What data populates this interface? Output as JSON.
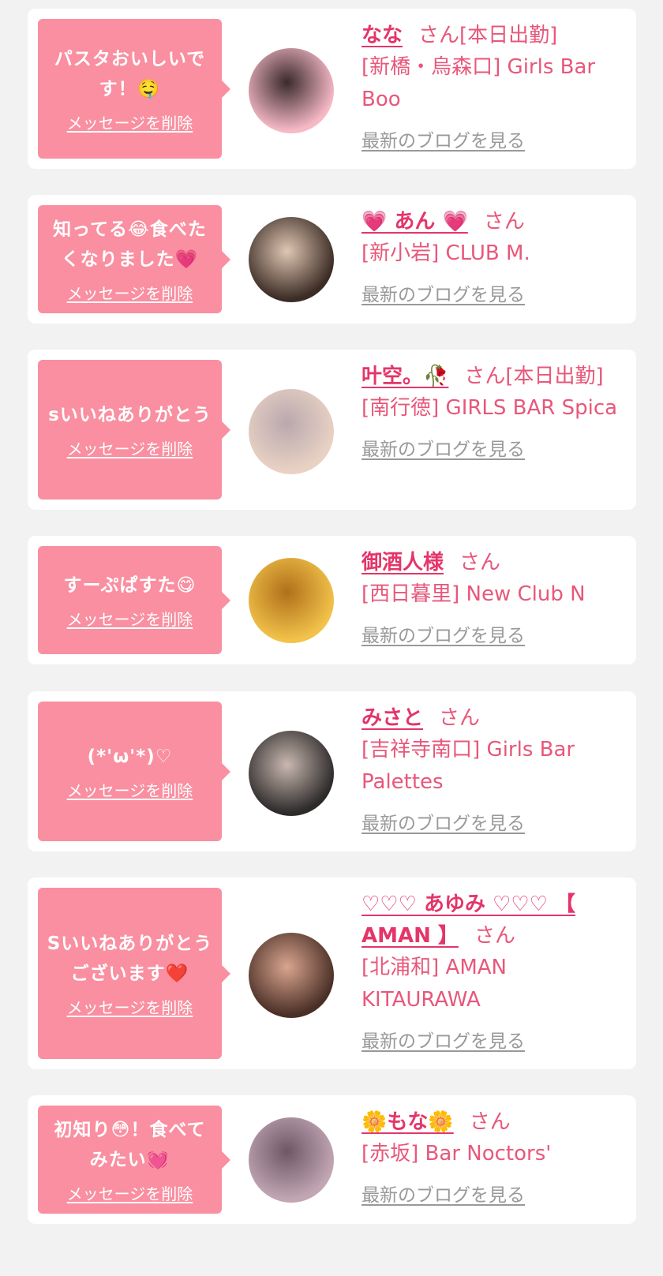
{
  "messages": [
    {
      "message": "パスタおいしいです！🤤",
      "delete_label": "メッセージを削除",
      "name": "なな",
      "suffix": "さん[本日出勤]",
      "shop": "[新橋・烏森口] Girls Bar Boo",
      "blog_label": "最新のブログを見る",
      "avatar_colors": [
        "#f6b9c6",
        "#3a2a2e"
      ]
    },
    {
      "message": "知ってる😂食べたくなりました💗",
      "delete_label": "メッセージを削除",
      "name": "💗 あん 💗",
      "suffix": "さん",
      "shop": "[新小岩] CLUB M.",
      "blog_label": "最新のブログを見る",
      "avatar_colors": [
        "#3b2c24",
        "#e0c6b4"
      ]
    },
    {
      "message": "sいいねありがとう",
      "delete_label": "メッセージを削除",
      "name": "叶空。🥀",
      "suffix": "さん[本日出勤]",
      "shop": "[南行徳] GIRLS BAR Spica",
      "blog_label": "最新のブログを見る",
      "avatar_colors": [
        "#e9d2c4",
        "#b9a8ae"
      ]
    },
    {
      "message": "すーぷぱすた😋",
      "delete_label": "メッセージを削除",
      "name": "御酒人様",
      "suffix": "さん",
      "shop": "[西日暮里] New Club N",
      "blog_label": "最新のブログを見る",
      "avatar_colors": [
        "#f2c24a",
        "#b0701a"
      ]
    },
    {
      "message": "(*'ω'*)♡",
      "delete_label": "メッセージを削除",
      "name": "みさと",
      "suffix": "さん",
      "shop": "[吉祥寺南口] Girls Bar Palettes",
      "blog_label": "最新のブログを見る",
      "avatar_colors": [
        "#2d2a2a",
        "#c9b8b0"
      ]
    },
    {
      "message": "Sいいねありがとうございます❤️",
      "delete_label": "メッセージを削除",
      "name": "♡♡♡ あゆみ ♡♡♡ 【 AMAN 】",
      "suffix": "さん",
      "shop": "[北浦和] AMAN KITAURAWA",
      "blog_label": "最新のブログを見る",
      "avatar_colors": [
        "#4a2f26",
        "#d9a58f"
      ]
    },
    {
      "message": "初知り😳！食べてみたい💓",
      "delete_label": "メッセージを削除",
      "name": "🌼もな🌼",
      "suffix": "さん",
      "shop": "[赤坂] Bar Noctors'",
      "blog_label": "最新のブログを見る",
      "avatar_colors": [
        "#c2a6b4",
        "#6e5866"
      ]
    }
  ]
}
